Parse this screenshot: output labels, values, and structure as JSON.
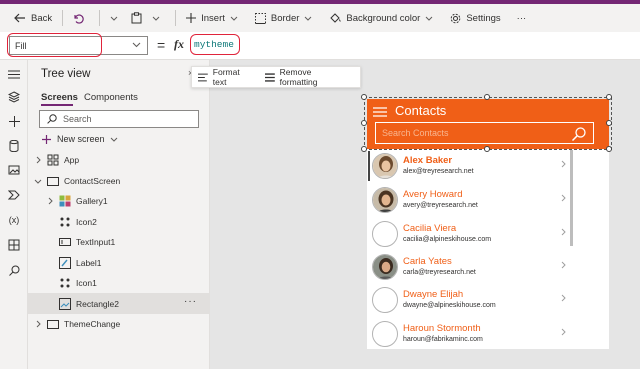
{
  "toolbar": {
    "back": "Back",
    "insert": "Insert",
    "border": "Border",
    "background_color": "Background color",
    "settings": "Settings",
    "more": "···"
  },
  "formula_bar": {
    "property": "Fill",
    "equals": "=",
    "fx": "fx",
    "formula": "mytheme"
  },
  "tree_view": {
    "title": "Tree view",
    "close": "×",
    "tabs": [
      {
        "label": "Screens",
        "selected": true
      },
      {
        "label": "Components",
        "selected": false
      }
    ],
    "search_placeholder": "Search",
    "new_screen": "New screen",
    "nodes": [
      {
        "label": "App",
        "icon": "app-icon"
      },
      {
        "label": "ContactScreen",
        "icon": "screen-icon"
      },
      {
        "label": "Gallery1",
        "icon": "gallery-icon"
      },
      {
        "label": "Icon2",
        "icon": "icon-control-icon"
      },
      {
        "label": "TextInput1",
        "icon": "textinput-icon"
      },
      {
        "label": "Label1",
        "icon": "label-icon"
      },
      {
        "label": "Icon1",
        "icon": "icon-control-icon"
      },
      {
        "label": "Rectangle2",
        "icon": "rectangle-icon",
        "selected": true
      },
      {
        "label": "ThemeChange",
        "icon": "screen-icon"
      }
    ],
    "node_more": "···"
  },
  "format_toolbar": {
    "format_text": "Format text",
    "remove_formatting": "Remove formatting"
  },
  "app_preview": {
    "title": "Contacts",
    "search_placeholder": "Search Contacts",
    "accent_color": "#f05f17",
    "contacts": [
      {
        "name": "Alex Baker",
        "email": "alex@treyresearch.net",
        "photo": true,
        "bold": true
      },
      {
        "name": "Avery Howard",
        "email": "avery@treyresearch.net",
        "photo": true,
        "bold": false
      },
      {
        "name": "Cacilia Viera",
        "email": "cacilia@alpineskihouse.com",
        "photo": false,
        "bold": false
      },
      {
        "name": "Carla Yates",
        "email": "carla@treyresearch.net",
        "photo": true,
        "bold": false
      },
      {
        "name": "Dwayne Elijah",
        "email": "dwayne@alpineskihouse.com",
        "photo": false,
        "bold": false
      },
      {
        "name": "Haroun Stormonth",
        "email": "haroun@fabrikaminc.com",
        "photo": false,
        "bold": false
      }
    ]
  }
}
